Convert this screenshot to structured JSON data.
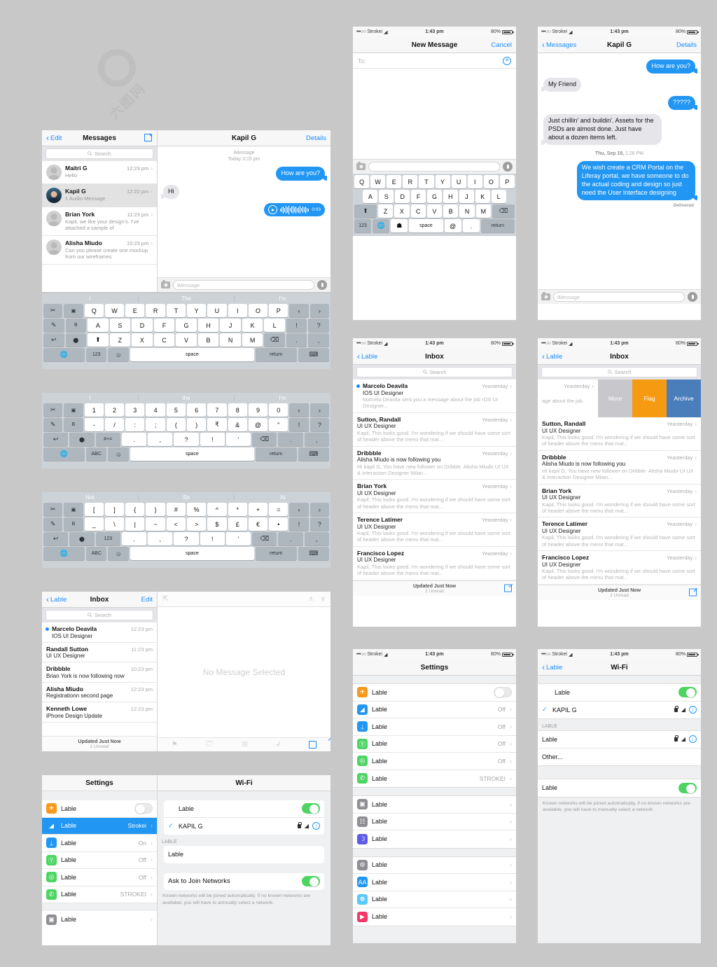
{
  "statusbar": {
    "dots": "•••○○",
    "carrier": "Strokei",
    "wifi": "▲",
    "time": "1:43 pm",
    "battery_pct": "80%"
  },
  "messages_ipad": {
    "nav": {
      "back": "Edit",
      "title": "Messages",
      "compose_icon": "compose-icon"
    },
    "search_placeholder": "Search",
    "conversations": [
      {
        "name": "Maitri G",
        "time": "12:23 pm",
        "preview": "Hello",
        "selected": false,
        "avatar": "placeholder-avatar"
      },
      {
        "name": "Kapil G",
        "time": "12:22 pm",
        "preview": "1 Audio Message",
        "selected": true,
        "avatar": "photo-avatar"
      },
      {
        "name": "Brian York",
        "time": "11:23 pm",
        "preview": "Kapil, we like your design's. I've attached a sample of",
        "selected": false,
        "avatar": "placeholder-avatar"
      },
      {
        "name": "Alisha Miudo",
        "time": "10:23 pm",
        "preview": "Can you please create one mockup from our wireframes",
        "selected": false,
        "avatar": "placeholder-avatar"
      }
    ],
    "chat": {
      "title": "Kapil G",
      "details": "Details",
      "meta_service": "iMessage",
      "meta_time": "Today 3:15 pm",
      "bubbles": [
        {
          "dir": "out",
          "text": "How are you?"
        },
        {
          "dir": "in",
          "text": "Hi"
        }
      ],
      "audio_duration": "0:03",
      "input_placeholder": "iMessage"
    }
  },
  "keyboards": [
    {
      "name": "letters-keyboard",
      "predictions": [
        "I",
        "The",
        "I'm"
      ],
      "left_col": [
        "scissors-icon",
        "highlighter-icon",
        "undo-icon"
      ],
      "left_col2": [
        "photo-icon",
        "B",
        "mic-icon"
      ],
      "rows": [
        [
          "Q",
          "W",
          "E",
          "R",
          "T",
          "Y",
          "U",
          "I",
          "O",
          "P"
        ],
        [
          "A",
          "S",
          "D",
          "F",
          "G",
          "H",
          "J",
          "K",
          "L"
        ],
        [
          "⬆",
          "Z",
          "X",
          "C",
          "V",
          "B",
          "N",
          "M",
          "⌫"
        ]
      ],
      "right_col": [
        "‹",
        "›",
        "!",
        "?",
        ".",
        ","
      ],
      "bottom": [
        "globe-icon",
        "123",
        "emoji-icon",
        "space",
        "return",
        "hide-keyboard-icon"
      ]
    },
    {
      "name": "numbers-keyboard",
      "predictions": [
        "I",
        "the",
        "I'm"
      ],
      "rows": [
        [
          "1",
          "2",
          "3",
          "4",
          "5",
          "6",
          "7",
          "8",
          "9",
          "0"
        ],
        [
          "-",
          "/",
          ":",
          ";",
          "(",
          ")",
          "₹",
          "&",
          "@",
          "\""
        ],
        [
          "#+=",
          ".",
          ",",
          "?",
          "!",
          "’",
          "⌫"
        ]
      ],
      "right_col": [
        "‹",
        "›",
        "!",
        "?",
        ".",
        ","
      ],
      "bottom": [
        "globe-icon",
        "ABC",
        "emoji-icon",
        "space",
        "return",
        "hide-keyboard-icon"
      ]
    },
    {
      "name": "symbols-keyboard",
      "predictions": [
        "Not",
        "So",
        "At"
      ],
      "rows": [
        [
          "[",
          "]",
          "{",
          "}",
          "#",
          "%",
          "^",
          "*",
          "+",
          "="
        ],
        [
          "_",
          "\\",
          "|",
          "~",
          "<",
          ">",
          "$",
          "£",
          "€",
          "•"
        ],
        [
          "123",
          ".",
          ",",
          "?",
          "!",
          "’",
          "⌫"
        ]
      ],
      "right_col": [
        "‹",
        "›",
        "!",
        "?",
        ".",
        ","
      ],
      "bottom": [
        "globe-icon",
        "ABC",
        "emoji-icon",
        "space",
        "return",
        "hide-keyboard-icon"
      ]
    }
  ],
  "mail_ipad": {
    "nav": {
      "back": "Lable",
      "title": "Inbox",
      "edit": "Edit"
    },
    "search_placeholder": "Search",
    "rows": [
      {
        "name": "Marcelo Deavila",
        "time": "12:23 pm",
        "subject": "IOS UI Designer",
        "unread": true
      },
      {
        "name": "Randall Sutton",
        "time": "11:23 pm",
        "subject": "UI UX Designer",
        "unread": false
      },
      {
        "name": "Dribbble",
        "time": "10:23 pm",
        "subject": "Brian York is now following now",
        "unread": false
      },
      {
        "name": "Alisha Miudo",
        "time": "12:23 pm",
        "subject": "Registrationn second page",
        "unread": false
      },
      {
        "name": "Kenneth Lowe",
        "time": "12:23 pm",
        "subject": "iPhone Design Update",
        "unread": false
      }
    ],
    "footer_primary": "Updated Just Now",
    "footer_secondary": "1 Unread",
    "empty_state": "No Message Selected",
    "toolbar_icons": [
      "flag-icon",
      "folder-icon",
      "trash-icon",
      "reply-icon",
      "compose-icon"
    ]
  },
  "settings_ipad": {
    "left_title": "Settings",
    "right_title": "Wi-Fi",
    "rows": [
      {
        "label": "Lable",
        "icon": "airplane-icon",
        "color": "#f59a1e",
        "control": "toggle-off"
      },
      {
        "label": "Lable",
        "icon": "wifi-icon",
        "color": "#2196f3",
        "value": "Strokei",
        "active": true
      },
      {
        "label": "Lable",
        "icon": "bluetooth-icon",
        "color": "#2196f3",
        "value": "On"
      },
      {
        "label": "Lable",
        "icon": "cellular-icon",
        "color": "#4cd562",
        "value": "Off"
      },
      {
        "label": "Lable",
        "icon": "hotspot-icon",
        "color": "#4cd562",
        "value": "Off"
      },
      {
        "label": "Lable",
        "icon": "phone-icon",
        "color": "#4cd562",
        "value": "STROKEI"
      },
      {
        "label": "Lable",
        "icon": "notifications-icon",
        "color": "#8e8e93",
        "value": ""
      }
    ],
    "wifi": {
      "toggle_label": "Lable",
      "toggle_on": true,
      "connected_network": "KAPIL G",
      "section_header": "Lable",
      "network_item": "Lable",
      "ask_label": "Ask to Join Networks",
      "ask_on": true,
      "footnote": "Known networks will be joined automatically. If no known networks are avallabel, you will have to amnually select a network."
    }
  },
  "new_message_phone": {
    "nav": {
      "title": "New Message",
      "cancel": "Cancel"
    },
    "to_label": "To:",
    "add_icon": "add-contact-icon",
    "input_placeholder": "",
    "keyboard": {
      "rows": [
        [
          "Q",
          "W",
          "E",
          "R",
          "T",
          "Y",
          "U",
          "I",
          "O",
          "P"
        ],
        [
          "A",
          "S",
          "D",
          "F",
          "G",
          "H",
          "J",
          "K",
          "L"
        ],
        [
          "⬆",
          "Z",
          "X",
          "C",
          "V",
          "B",
          "N",
          "M",
          "⌫"
        ]
      ],
      "bottom": [
        "123",
        "globe-icon",
        "mic-icon",
        "space",
        "@",
        ".",
        "return"
      ]
    }
  },
  "chat_phone": {
    "nav": {
      "back": "Messages",
      "title": "Kapil G",
      "details": "Details"
    },
    "bubbles": [
      {
        "dir": "out",
        "text": "How are you?"
      },
      {
        "dir": "in",
        "text": "My Friend"
      },
      {
        "dir": "out",
        "text": "?????"
      },
      {
        "dir": "in",
        "text": "Just chillin' and buildin'. Assets for the PSDs are almost done. Just have about a dozen items left."
      }
    ],
    "timestamp_bold": "Thu, Sep 19,",
    "timestamp_rest": " 1:26 PM",
    "long_bubble": "We wish create a CRM Portal on the Liferay portal, we have someone to do the actual coding and design so just need the User Interface designing",
    "delivered": "Delivered",
    "input_placeholder": "iMessage"
  },
  "inbox_phone": {
    "nav": {
      "back": "Lable",
      "title": "Inbox"
    },
    "search_placeholder": "Search",
    "rows": [
      {
        "name": "Marcelo Deavila",
        "time": "Yeasterday",
        "subject": "IOS UI Designer",
        "preview": "Marcelo Deavila sent you a message about the job IOS UI Designer...",
        "unread": true
      },
      {
        "name": "Sutton, Randall",
        "time": "Yeasterday",
        "subject": "UI UX Designer",
        "preview": "Kapil, This looks good. I'm wondering if we should have some sort of header above the menu that mat...",
        "unread": false
      },
      {
        "name": "Dribbble",
        "time": "Yeasterday",
        "subject": "Alisha Miudo is now following you",
        "preview": "HI kapil G, You have new follower on Dribble. Alisha Miudo UI UX & Interaction Designer Milan...",
        "unread": false
      },
      {
        "name": "Brian York",
        "time": "Yeasterday",
        "subject": "UI UX Designer",
        "preview": "Kapil, This looks good. I'm wondering if we should have some sort of header above the menu that mat...",
        "unread": false
      },
      {
        "name": "Terence  Latimer",
        "time": "Yeasterday",
        "subject": "UI UX Designer",
        "preview": "Kapil, This looks good. I'm wondering if we should have some sort of header above the menu that mat...",
        "unread": false
      },
      {
        "name": "Francisco Lopez",
        "time": "Yeasterday",
        "subject": "UI UX Designer",
        "preview": "Kapil, This looks good. I'm wondering if we should have some sort of header above the menu that mat...",
        "unread": false
      }
    ],
    "footer_primary": "Updated Just Now",
    "footer_secondary": "2 Unread"
  },
  "inbox_swipe_phone": {
    "nav": {
      "back": "Lable",
      "title": "Inbox"
    },
    "search_placeholder": "Search",
    "swipe_row": {
      "time": "Yeasterday",
      "preview_tail": "age about the job"
    },
    "swipe_actions": [
      {
        "label": "More",
        "color": "#c7c7cc"
      },
      {
        "label": "Flag",
        "color": "#f69a12"
      },
      {
        "label": "Archive",
        "color": "#4a7ebb"
      }
    ],
    "footer_primary": "Updated Just Now",
    "footer_secondary": "2 Unread"
  },
  "settings_phone": {
    "title": "Settings",
    "group1": [
      {
        "label": "Lable",
        "icon": "airplane-icon",
        "color": "#f59a1e",
        "control": "toggle-off"
      },
      {
        "label": "Lable",
        "icon": "wifi-icon",
        "color": "#2196f3",
        "value": "Off"
      },
      {
        "label": "Lable",
        "icon": "bluetooth-icon",
        "color": "#2196f3",
        "value": "Off"
      },
      {
        "label": "Lable",
        "icon": "cellular-icon",
        "color": "#4cd562",
        "value": "Off"
      },
      {
        "label": "Lable",
        "icon": "hotspot-icon",
        "color": "#4cd562",
        "value": "Off"
      },
      {
        "label": "Lable",
        "icon": "phone-icon",
        "color": "#4cd562",
        "value": "STROKEI"
      }
    ],
    "group2": [
      {
        "label": "Lable",
        "icon": "notifications-icon",
        "color": "#8e8e93",
        "value": ""
      },
      {
        "label": "Lable",
        "icon": "control-center-icon",
        "color": "#8e8e93",
        "value": ""
      },
      {
        "label": "Lable",
        "icon": "do-not-disturb-icon",
        "color": "#5e5ce6",
        "value": ""
      }
    ],
    "group3": [
      {
        "label": "Lable",
        "icon": "gear-icon",
        "color": "#8e8e93",
        "value": ""
      },
      {
        "label": "Lable",
        "icon": "display-icon",
        "color": "#2196f3",
        "value": ""
      },
      {
        "label": "Lable",
        "icon": "wallpaper-icon",
        "color": "#5ac8fa",
        "value": ""
      },
      {
        "label": "Lable",
        "icon": "sounds-icon",
        "color": "#f4366a",
        "value": ""
      }
    ]
  },
  "wifi_phone": {
    "nav": {
      "back": "Lable",
      "title": "Wi-Fi"
    },
    "toggle_label": "Lable",
    "toggle_on": true,
    "connected_network": "KAPIL G",
    "section_header": "LABLE",
    "network_item": "Lable",
    "other_item": "Other...",
    "ask_label": "Lable",
    "ask_on": true,
    "footnote": "Known networks will be joined automatically, if no known networks are available, you will have to manually select a network."
  },
  "colors": {
    "accent": "#2196f3",
    "green": "#4cd562",
    "orange": "#f59a1e",
    "flag": "#f69a12",
    "archive": "#4a7ebb",
    "more": "#c7c7cc"
  }
}
